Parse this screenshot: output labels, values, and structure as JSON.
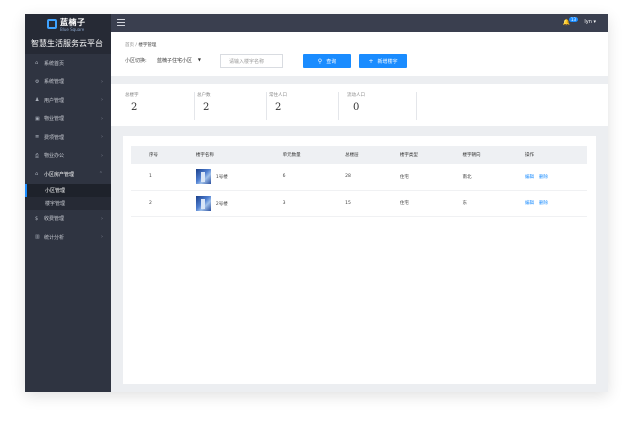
{
  "logo": {
    "name": "蓝楠子",
    "sub": "Blue Square",
    "platform": "智慧生活服务云平台"
  },
  "menu": {
    "items": [
      {
        "label": "系统首页",
        "icon": "home-icon",
        "glyph": "⌂"
      },
      {
        "label": "系统管理",
        "icon": "gear-icon",
        "glyph": "⚙",
        "chevron": "›"
      },
      {
        "label": "用户管理",
        "icon": "user-icon",
        "glyph": "♟",
        "chevron": "›"
      },
      {
        "label": "物业管理",
        "icon": "building-icon",
        "glyph": "▣",
        "chevron": "›"
      },
      {
        "label": "费项管理",
        "icon": "list-icon",
        "glyph": "≣",
        "chevron": "›"
      },
      {
        "label": "物业办公",
        "icon": "print-icon",
        "glyph": "⎙",
        "chevron": "›"
      },
      {
        "label": "小区房产管理",
        "icon": "house-icon",
        "glyph": "⌂",
        "chevron": "⌃"
      }
    ],
    "sub_items": [
      {
        "label": "小区管理"
      },
      {
        "label": "楼宇管理"
      }
    ],
    "items_after": [
      {
        "label": "收费管理",
        "icon": "fee-icon",
        "glyph": "$",
        "chevron": "›"
      },
      {
        "label": "统计分析",
        "icon": "chart-icon",
        "glyph": "▥",
        "chevron": "›"
      }
    ]
  },
  "topbar": {
    "badge": "13",
    "user": "lyn ▾",
    "bell": "🔔"
  },
  "filter": {
    "breadcrumb_home": "首页",
    "breadcrumb_sep": " / ",
    "breadcrumb_current": "楼宇管理",
    "community_label": "小区切换:",
    "community_value": "蓝楠子住宅小区",
    "select_arrow": "▼",
    "search_placeholder": "请输入楼宇名称",
    "search_button": "查询",
    "add_button": "新增楼宇"
  },
  "stats": [
    {
      "label": "总楼宇",
      "value": "2"
    },
    {
      "label": "总户数",
      "value": "2"
    },
    {
      "label": "常住人口",
      "value": "2"
    },
    {
      "label": "流动人口",
      "value": "0"
    }
  ],
  "table": {
    "headers": [
      "序号",
      "楼宇名称",
      "单元数量",
      "总楼层",
      "楼宇类型",
      "楼宇朝向",
      "操作"
    ],
    "rows": [
      {
        "no": "1",
        "name": "1号楼",
        "units": "6",
        "floors": "28",
        "type": "住宅",
        "facing": "南北",
        "edit": "编辑",
        "delete": "删除"
      },
      {
        "no": "2",
        "name": "2号楼",
        "units": "3",
        "floors": "15",
        "type": "住宅",
        "facing": "东",
        "edit": "编辑",
        "delete": "删除"
      }
    ]
  }
}
